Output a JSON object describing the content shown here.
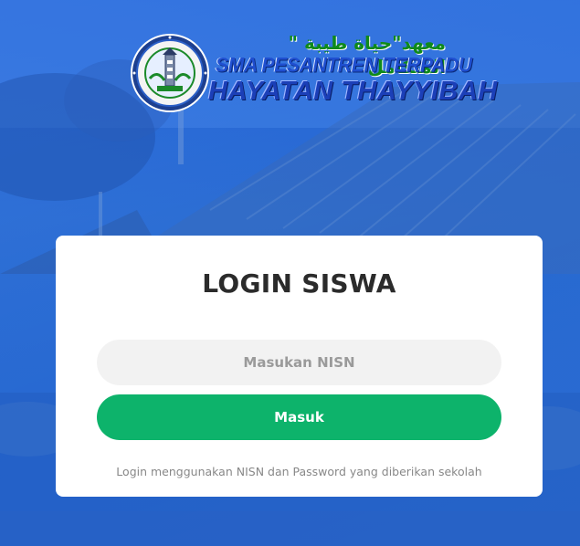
{
  "logo": {
    "arabic_text": "معهد\"حياة طيبة \" المتكامل",
    "line1": "SMA PESANTREN TERPADU",
    "line2": "HAYATAN THAYYIBAH",
    "emblem_ring_text": "PESANTREN TERPADU HAYATAN THAYYIBAH"
  },
  "login": {
    "title": "LOGIN SISWA",
    "nisn_placeholder": "Masukan NISN",
    "nisn_value": "",
    "submit_label": "Masuk",
    "hint": "Login menggunakan NISN dan Password yang diberikan sekolah"
  },
  "colors": {
    "accent": "#0db36b",
    "background": "#2a6fe0",
    "card": "#ffffff"
  }
}
